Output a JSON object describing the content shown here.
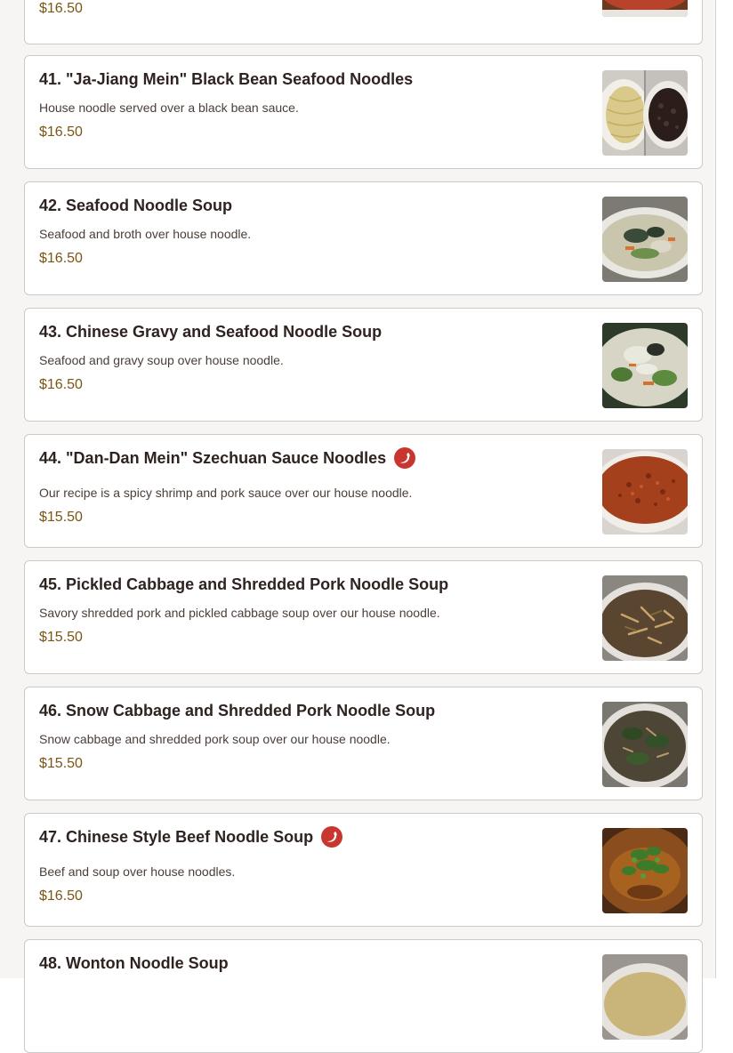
{
  "menu": {
    "partial_top_price": "$16.50",
    "items": [
      {
        "title": "41. \"Ja-Jiang Mein\" Black Bean Seafood Noodles",
        "description": "House noodle served over a black bean sauce.",
        "price": "$16.50",
        "spicy": false,
        "image": "ja-jiang-mein-photo"
      },
      {
        "title": "42. Seafood Noodle Soup",
        "description": "Seafood and broth over house noodle.",
        "price": "$16.50",
        "spicy": false,
        "image": "seafood-noodle-soup-photo"
      },
      {
        "title": "43. Chinese Gravy and Seafood Noodle Soup",
        "description": "Seafood and gravy soup over house noodle.",
        "price": "$16.50",
        "spicy": false,
        "image": "gravy-seafood-noodle-soup-photo"
      },
      {
        "title": "44. \"Dan-Dan Mein\" Szechuan Sauce Noodles",
        "description": "Our recipe is a spicy shrimp and pork sauce over our house noodle.",
        "price": "$15.50",
        "spicy": true,
        "image": "dan-dan-mein-photo"
      },
      {
        "title": "45. Pickled Cabbage and Shredded Pork Noodle Soup",
        "description": "Savory shredded pork and pickled cabbage soup over our house noodle.",
        "price": "$15.50",
        "spicy": false,
        "image": "pickled-cabbage-soup-photo"
      },
      {
        "title": "46. Snow Cabbage and Shredded Pork Noodle Soup",
        "description": "Snow cabbage and shredded pork soup over our house noodle.",
        "price": "$15.50",
        "spicy": false,
        "image": "snow-cabbage-soup-photo"
      },
      {
        "title": "47. Chinese Style Beef Noodle Soup",
        "description": "Beef and soup over house noodles.",
        "price": "$16.50",
        "spicy": true,
        "image": "beef-noodle-soup-photo"
      },
      {
        "title": "48. Wonton Noodle Soup",
        "description": "",
        "price": "",
        "spicy": false,
        "image": "wonton-noodle-soup-photo"
      }
    ]
  },
  "colors": {
    "price": "#7a5614",
    "spicy_badge": "#c9352f",
    "card_border": "#cfc9c4",
    "page_background": "#f7f5f3"
  }
}
